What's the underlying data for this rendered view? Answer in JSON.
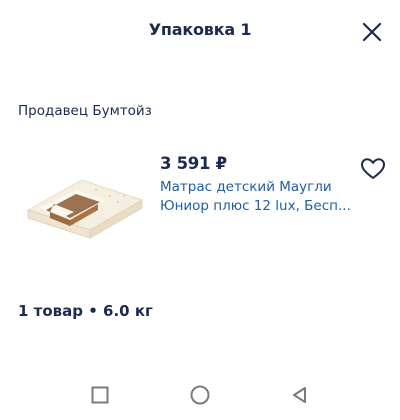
{
  "header": {
    "title": "Упаковка 1",
    "close_icon": "close-icon"
  },
  "seller": {
    "label": "Продавец Бумтойз"
  },
  "product": {
    "price": "3 591 ₽",
    "name_line1": "Матрас детский Маугли",
    "name_line2": "Юниор плюс 12 lux, Бесп...",
    "favorite_icon": "heart-outline-icon"
  },
  "summary": {
    "text": "1 товар • 6.0 кг"
  },
  "nav": {
    "icons": [
      "square-icon",
      "circle-icon",
      "triangle-back-icon"
    ]
  },
  "colors": {
    "text_dark": "#1b2a4e",
    "link": "#1f5ea8",
    "nav_gray": "#7a7a7a"
  }
}
